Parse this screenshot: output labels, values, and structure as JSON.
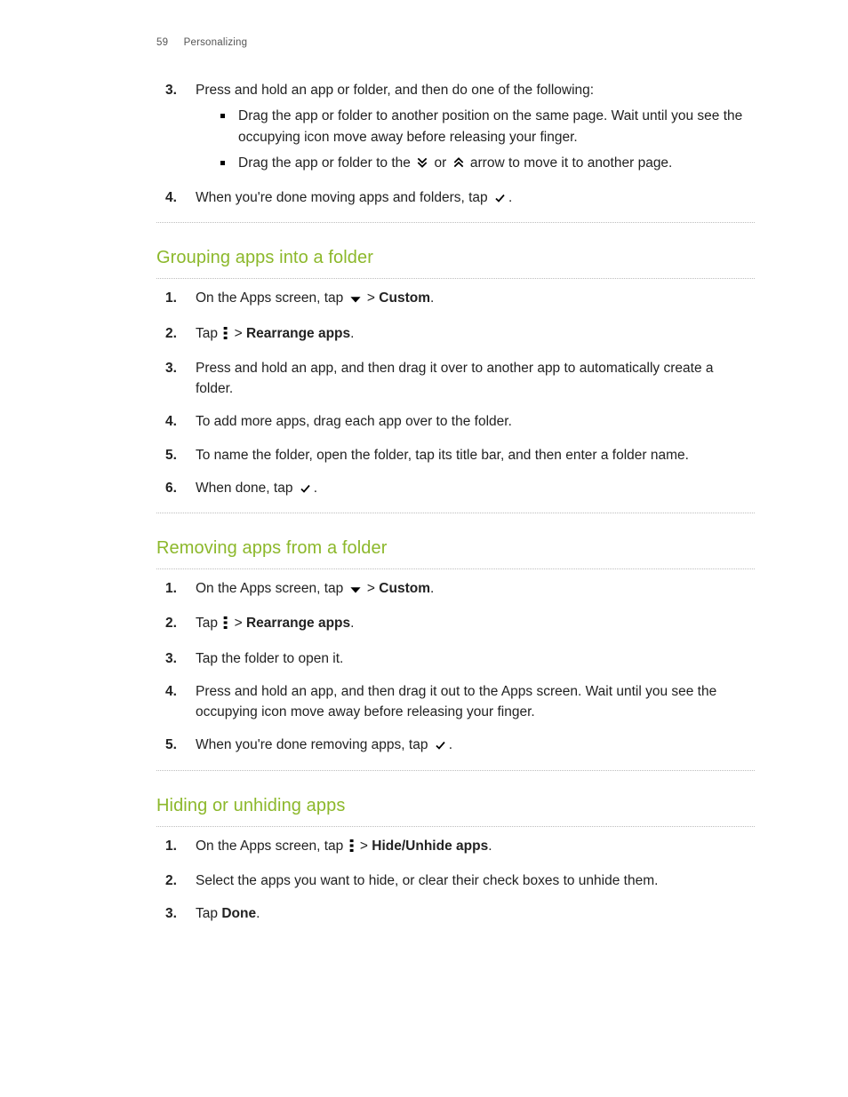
{
  "header": {
    "page_number": "59",
    "chapter": "Personalizing"
  },
  "intro_steps": {
    "s3_text": "Press and hold an app or folder, and then do one of the following:",
    "s3_b1": "Drag the app or folder to another position on the same page. Wait until you see the occupying icon move away before releasing your finger.",
    "s3_b2_a": "Drag the app or folder to the ",
    "s3_b2_b": " or ",
    "s3_b2_c": " arrow to move it to another page.",
    "s4_a": "When you're done moving apps and folders, tap ",
    "s4_b": "."
  },
  "grouping": {
    "heading": "Grouping apps into a folder",
    "s1_a": "On the Apps screen, tap ",
    "s1_b": " > ",
    "s1_c": "Custom",
    "s1_d": ".",
    "s2_a": "Tap ",
    "s2_b": " > ",
    "s2_c": "Rearrange apps",
    "s2_d": ".",
    "s3": "Press and hold an app, and then drag it over to another app to automatically create a folder.",
    "s4": "To add more apps, drag each app over to the folder.",
    "s5": "To name the folder, open the folder, tap its title bar, and then enter a folder name.",
    "s6_a": "When done, tap ",
    "s6_b": "."
  },
  "removing": {
    "heading": "Removing apps from a folder",
    "s1_a": "On the Apps screen, tap ",
    "s1_b": " > ",
    "s1_c": "Custom",
    "s1_d": ".",
    "s2_a": "Tap ",
    "s2_b": " > ",
    "s2_c": "Rearrange apps",
    "s2_d": ".",
    "s3": "Tap the folder to open it.",
    "s4": "Press and hold an app, and then drag it out to the Apps screen. Wait until you see the occupying icon move away before releasing your finger.",
    "s5_a": "When you're done removing apps, tap ",
    "s5_b": "."
  },
  "hiding": {
    "heading": "Hiding or unhiding apps",
    "s1_a": "On the Apps screen, tap ",
    "s1_b": " > ",
    "s1_c": "Hide/Unhide apps",
    "s1_d": ".",
    "s2": "Select the apps you want to hide, or clear their check boxes to unhide them.",
    "s3_a": "Tap ",
    "s3_b": "Done",
    "s3_c": "."
  },
  "labels": {
    "n1": "1.",
    "n2": "2.",
    "n3": "3.",
    "n4": "4.",
    "n5": "5.",
    "n6": "6."
  }
}
